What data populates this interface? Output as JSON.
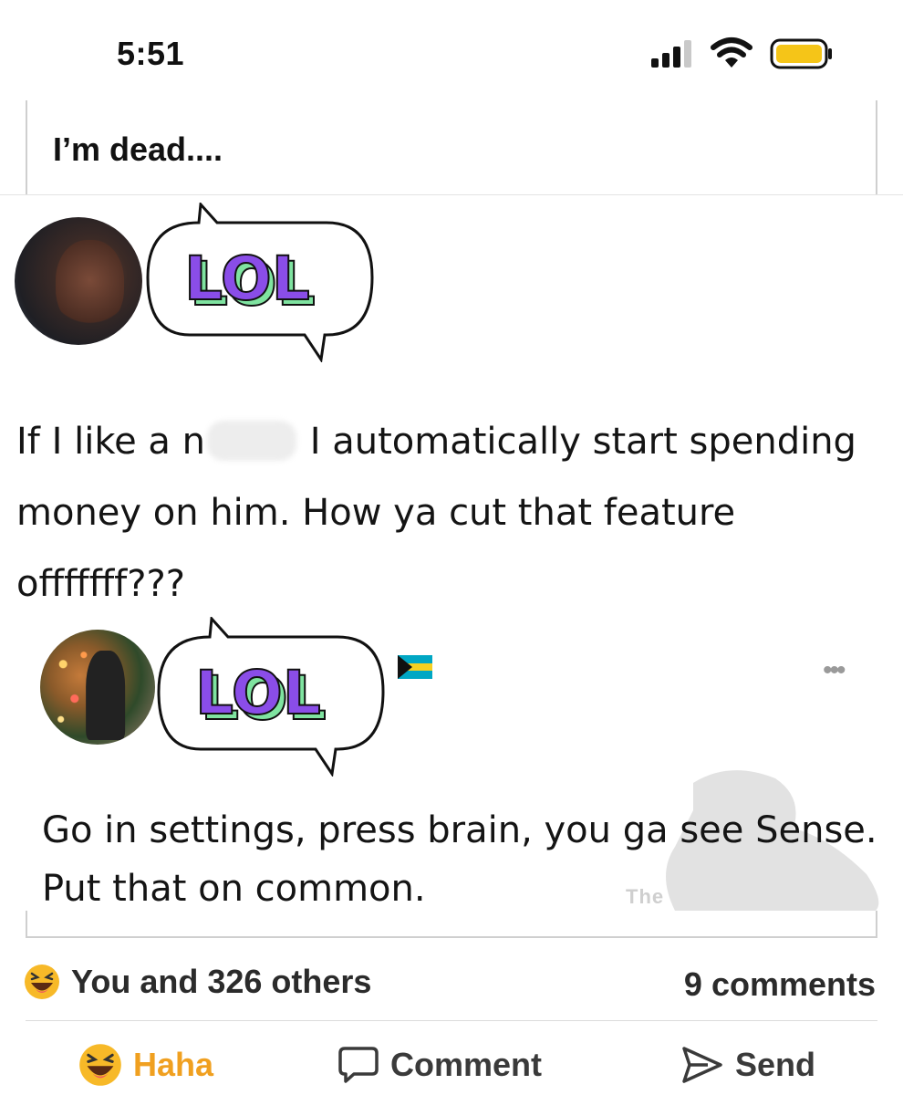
{
  "status_bar": {
    "time": "5:51",
    "signal_icon": "cellular-signal-icon",
    "wifi_icon": "wifi-icon",
    "battery_icon": "battery-icon",
    "battery_color": "#f5c518"
  },
  "post": {
    "text": "I’m dead...."
  },
  "tweet_1": {
    "overlay_sticker": "LOL",
    "body_part_1": "If I like a n",
    "body_part_2": " I automatically start spending money on him. How ya cut that feature offfffff???"
  },
  "tweet_2": {
    "overlay_sticker": "LOL",
    "flag_icon": "bahamas-flag-icon",
    "more_icon": "more-dots-icon",
    "more_glyph": "•••",
    "body": "Go in settings, press brain, you ga see Sense. Put that on common.",
    "watermark_text": "The"
  },
  "reactions": {
    "emoji_icon": "haha-emoji-icon",
    "summary": "You and 326 others",
    "comments": "9 comments"
  },
  "actions": {
    "haha_label": "Haha",
    "comment_label": "Comment",
    "send_label": "Send",
    "haha_color": "#f0a020"
  },
  "colors": {
    "sticker_fill": "#8a4de8",
    "sticker_shadow": "#7fe3a0"
  }
}
